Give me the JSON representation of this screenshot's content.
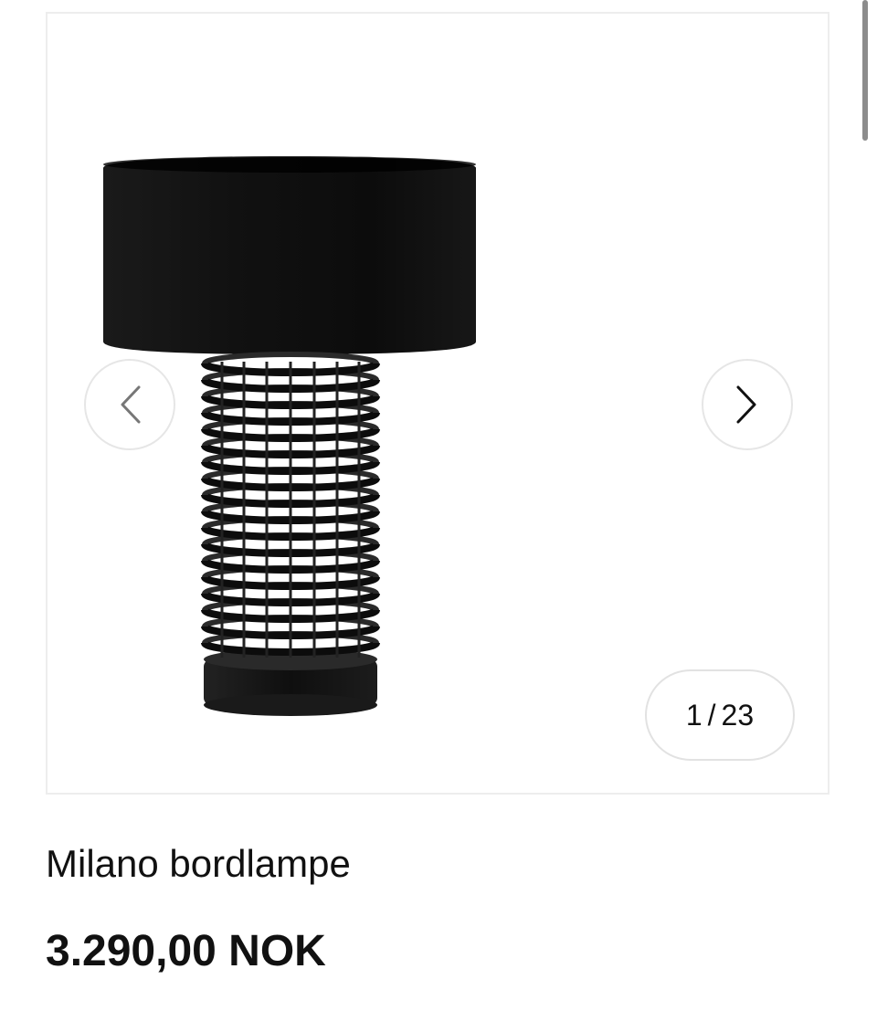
{
  "gallery": {
    "prev_icon": "chevron-left-icon",
    "next_icon": "chevron-right-icon",
    "counter": {
      "current": "1",
      "separator": "/",
      "total": "23"
    }
  },
  "product": {
    "name": "Milano bordlampe",
    "price": "3.290,00 NOK"
  },
  "colors": {
    "lamp": "#111111",
    "border": "#ededed",
    "button_border": "#e6e6e6",
    "text": "#111111"
  }
}
